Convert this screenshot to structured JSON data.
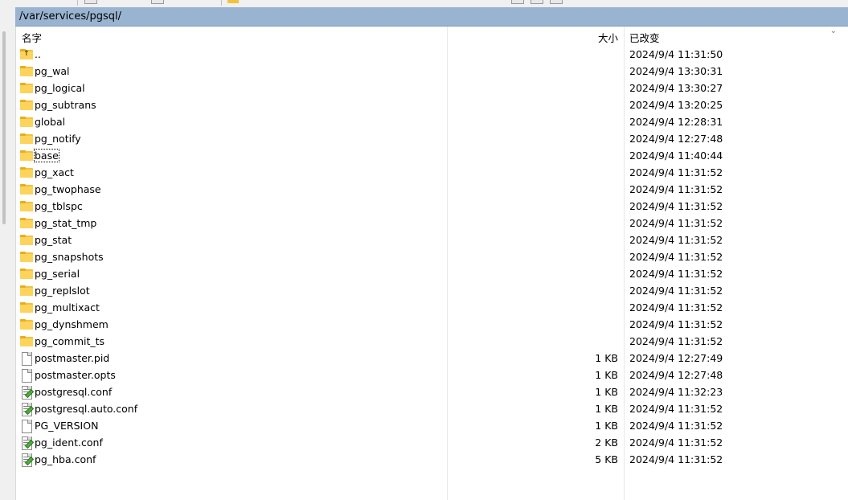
{
  "path": "/var/services/pgsql/",
  "columns": {
    "name": "名字",
    "size": "大小",
    "modified": "已改变"
  },
  "rows": [
    {
      "name": "..",
      "size": "",
      "modified": "2024/9/4 11:31:50",
      "type": "parent"
    },
    {
      "name": "pg_wal",
      "size": "",
      "modified": "2024/9/4 13:30:31",
      "type": "folder"
    },
    {
      "name": "pg_logical",
      "size": "",
      "modified": "2024/9/4 13:30:27",
      "type": "folder"
    },
    {
      "name": "pg_subtrans",
      "size": "",
      "modified": "2024/9/4 13:20:25",
      "type": "folder"
    },
    {
      "name": "global",
      "size": "",
      "modified": "2024/9/4 12:28:31",
      "type": "folder"
    },
    {
      "name": "pg_notify",
      "size": "",
      "modified": "2024/9/4 12:27:48",
      "type": "folder"
    },
    {
      "name": "base",
      "size": "",
      "modified": "2024/9/4 11:40:44",
      "type": "folder",
      "focused": true
    },
    {
      "name": "pg_xact",
      "size": "",
      "modified": "2024/9/4 11:31:52",
      "type": "folder"
    },
    {
      "name": "pg_twophase",
      "size": "",
      "modified": "2024/9/4 11:31:52",
      "type": "folder"
    },
    {
      "name": "pg_tblspc",
      "size": "",
      "modified": "2024/9/4 11:31:52",
      "type": "folder"
    },
    {
      "name": "pg_stat_tmp",
      "size": "",
      "modified": "2024/9/4 11:31:52",
      "type": "folder"
    },
    {
      "name": "pg_stat",
      "size": "",
      "modified": "2024/9/4 11:31:52",
      "type": "folder"
    },
    {
      "name": "pg_snapshots",
      "size": "",
      "modified": "2024/9/4 11:31:52",
      "type": "folder"
    },
    {
      "name": "pg_serial",
      "size": "",
      "modified": "2024/9/4 11:31:52",
      "type": "folder"
    },
    {
      "name": "pg_replslot",
      "size": "",
      "modified": "2024/9/4 11:31:52",
      "type": "folder"
    },
    {
      "name": "pg_multixact",
      "size": "",
      "modified": "2024/9/4 11:31:52",
      "type": "folder"
    },
    {
      "name": "pg_dynshmem",
      "size": "",
      "modified": "2024/9/4 11:31:52",
      "type": "folder"
    },
    {
      "name": "pg_commit_ts",
      "size": "",
      "modified": "2024/9/4 11:31:52",
      "type": "folder"
    },
    {
      "name": "postmaster.pid",
      "size": "1 KB",
      "modified": "2024/9/4 12:27:49",
      "type": "file"
    },
    {
      "name": "postmaster.opts",
      "size": "1 KB",
      "modified": "2024/9/4 12:27:48",
      "type": "file"
    },
    {
      "name": "postgresql.conf",
      "size": "1 KB",
      "modified": "2024/9/4 11:32:23",
      "type": "conf"
    },
    {
      "name": "postgresql.auto.conf",
      "size": "1 KB",
      "modified": "2024/9/4 11:31:52",
      "type": "conf"
    },
    {
      "name": "PG_VERSION",
      "size": "1 KB",
      "modified": "2024/9/4 11:31:52",
      "type": "file"
    },
    {
      "name": "pg_ident.conf",
      "size": "2 KB",
      "modified": "2024/9/4 11:31:52",
      "type": "conf"
    },
    {
      "name": "pg_hba.conf",
      "size": "5 KB",
      "modified": "2024/9/4 11:31:52",
      "type": "conf"
    }
  ],
  "colors": {
    "path_bar": "#99b4d1",
    "folder": "#fcd45c"
  }
}
